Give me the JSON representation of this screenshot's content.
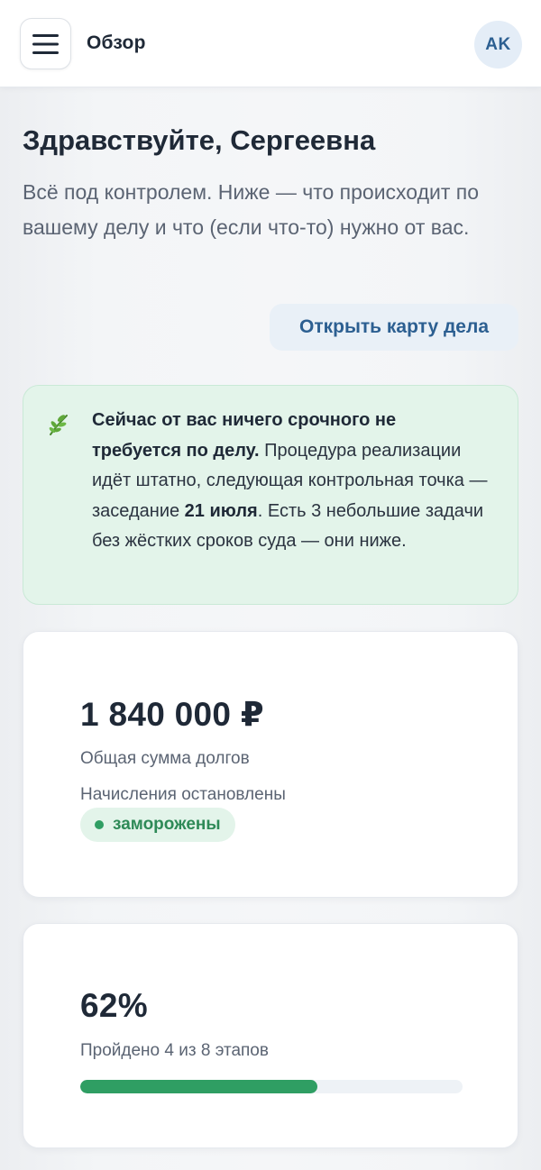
{
  "header": {
    "title": "Обзор",
    "avatar_initials": "AK"
  },
  "greeting": {
    "title": "Здравствуйте, Сергеевна",
    "intro": "Всё под контролем. Ниже — что происходит по вашему делу и что (если что-то) нужно от вас."
  },
  "actions": {
    "open_case_label": "Открыть карту дела"
  },
  "notice": {
    "icon": "sprout-icon",
    "bold_lead": "Сейчас от вас ничего срочного не требуется по делу.",
    "text_1": " Процедура реализации идёт штатно, следующая контрольная точка — заседание ",
    "bold_date": "21 июля",
    "text_2": ". Есть 3 небольшие задачи без жёстких сроков суда — они ниже."
  },
  "debt_card": {
    "amount": "1 840 000 ₽",
    "label": "Общая сумма долгов",
    "accruals_label": "Начисления остановлены",
    "status_badge": "заморожены"
  },
  "progress_card": {
    "percent_text": "62%",
    "label": "Пройдено 4 из 8 этапов",
    "progress": 0.62
  },
  "colors": {
    "accent": "#2c5f91",
    "success": "#2f9e63",
    "success_bg": "#e3f4ea"
  }
}
